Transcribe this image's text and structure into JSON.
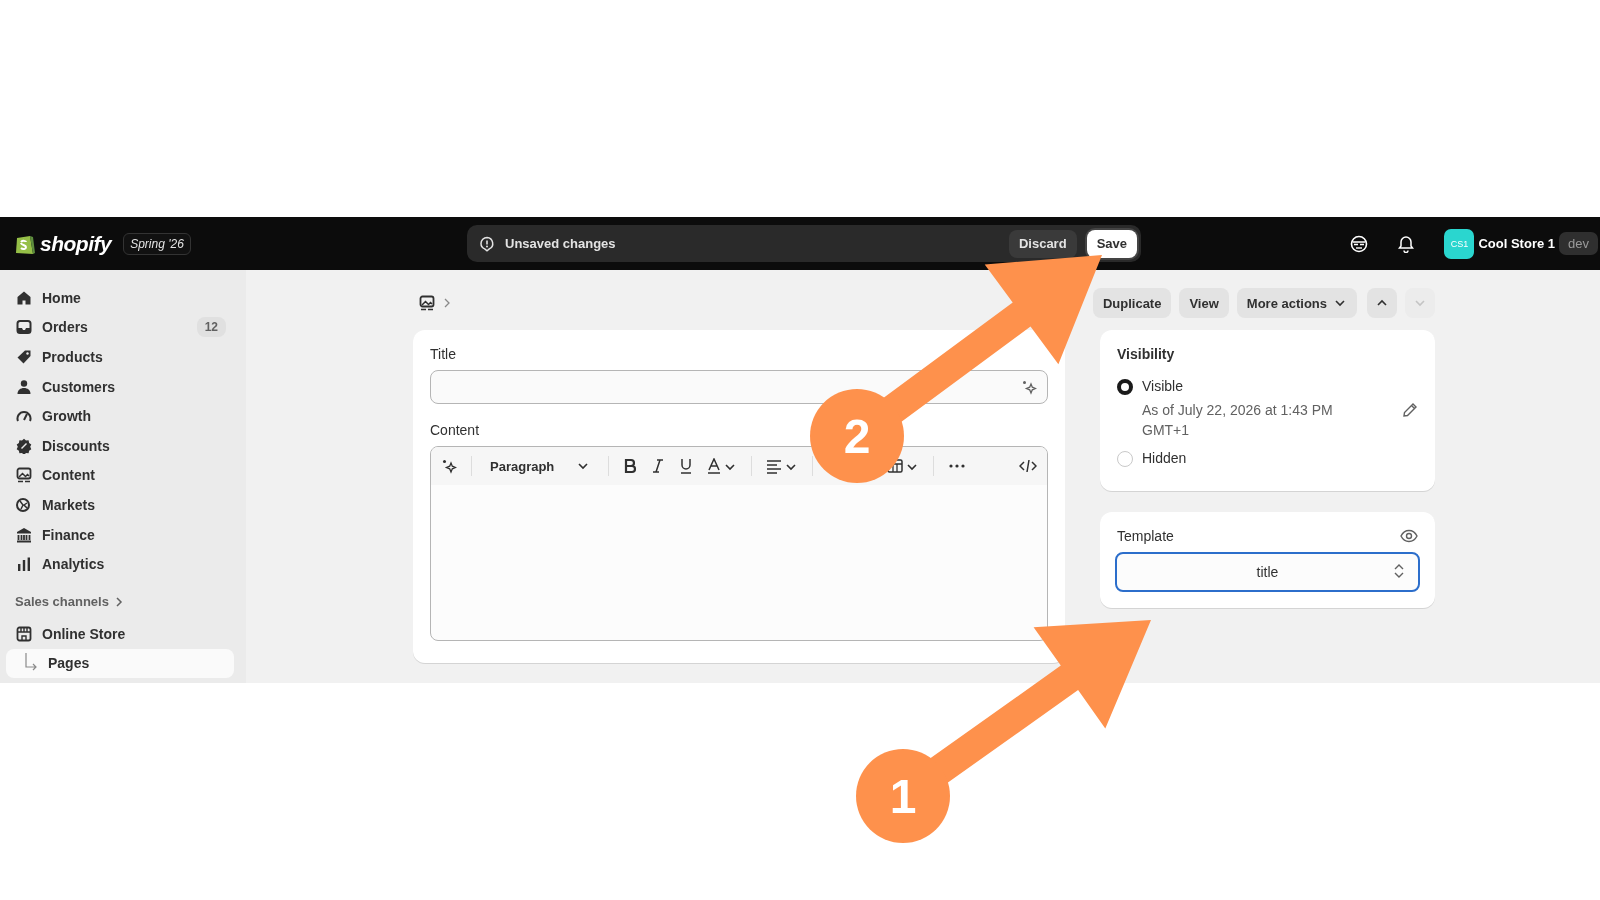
{
  "topbar": {
    "logo": "shopify",
    "edition": "Spring '26",
    "unsaved_bar": {
      "message": "Unsaved changes",
      "buttons": [
        {
          "label": "Discard",
          "kind": "secondary"
        },
        {
          "label": "Save",
          "kind": "primary"
        }
      ]
    },
    "store": {
      "initials": "CS1",
      "name": "Cool Store 1",
      "badge": "dev"
    }
  },
  "sidebar": {
    "items": [
      {
        "label": "Home",
        "selected": false
      },
      {
        "label": "Orders",
        "badge": "12",
        "selected": false
      },
      {
        "label": "Products",
        "selected": false
      },
      {
        "label": "Customers",
        "selected": false
      },
      {
        "label": "Growth",
        "selected": false
      },
      {
        "label": "Discounts",
        "selected": false
      },
      {
        "label": "Content",
        "selected": false
      },
      {
        "label": "Markets",
        "selected": false
      },
      {
        "label": "Finance",
        "selected": false
      },
      {
        "label": "Analytics",
        "selected": false
      }
    ],
    "section": "Sales channels",
    "channels": [
      {
        "label": "Online Store",
        "selected": false,
        "children": [
          {
            "label": "Pages",
            "selected": true
          }
        ]
      }
    ]
  },
  "page_actions": {
    "buttons": [
      "Duplicate",
      "View"
    ],
    "more": "More actions",
    "nav": [
      {
        "disabled": false
      },
      {
        "disabled": true
      }
    ]
  },
  "editor": {
    "title_label": "Title",
    "content_label": "Content",
    "format": "Paragraph"
  },
  "visibility": {
    "heading": "Visibility",
    "options": [
      {
        "label": "Visible",
        "selected": true,
        "detail": "As of July 22, 2026 at 1:43 PM GMT+1"
      },
      {
        "label": "Hidden",
        "selected": false
      }
    ]
  },
  "template": {
    "label": "Template",
    "value": "title"
  },
  "annotations": [
    {
      "number": "2"
    },
    {
      "number": "1"
    }
  ]
}
